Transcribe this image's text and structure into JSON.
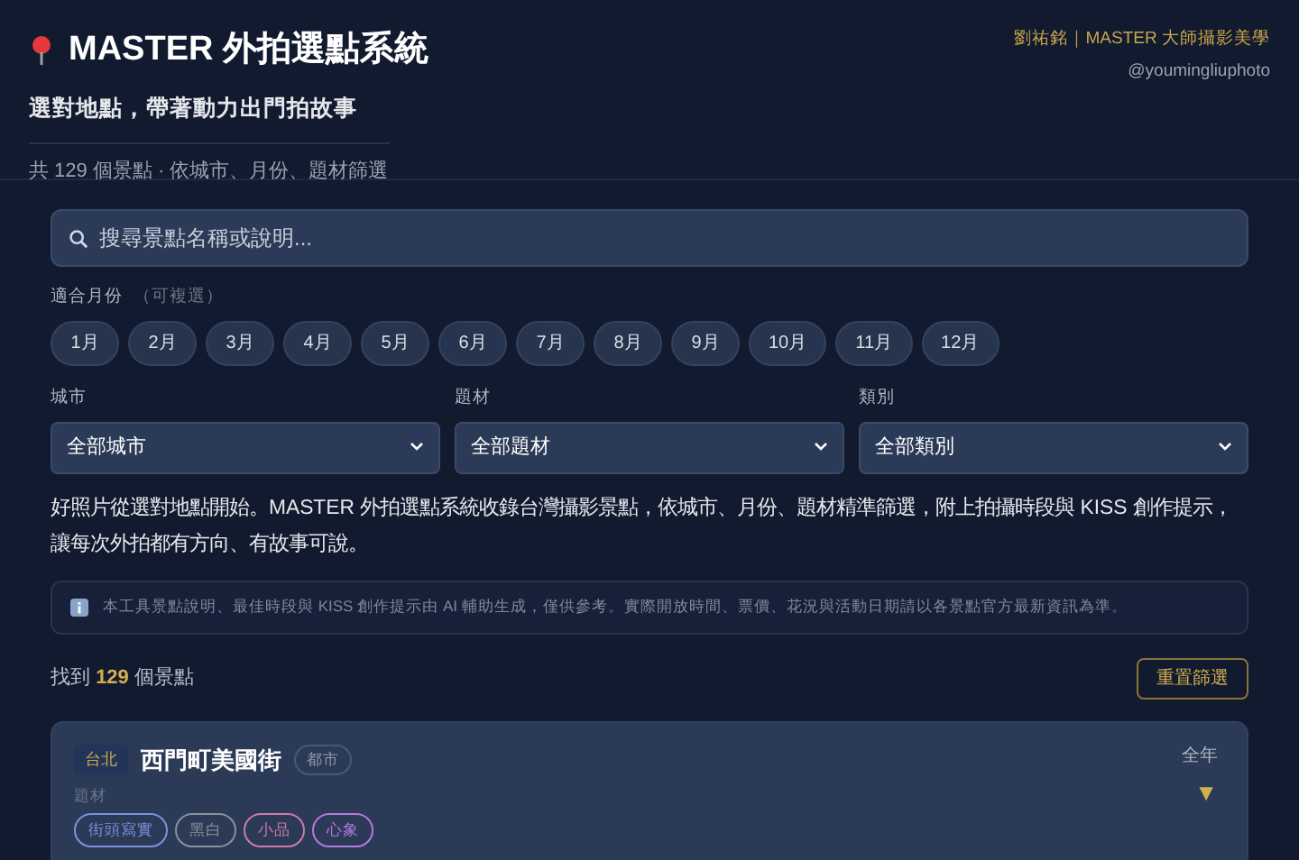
{
  "header": {
    "title": "MASTER 外拍選點系統",
    "subtitle": "選對地點，帶著動力出門拍故事",
    "summary": "共 129 個景點 · 依城市、月份、題材篩選",
    "author": "劉祐銘｜MASTER 大師攝影美學",
    "handle": "@youmingliuphoto"
  },
  "search": {
    "placeholder": "搜尋景點名稱或說明..."
  },
  "months": {
    "label": "適合月份",
    "hint": "（可複選）",
    "items": [
      {
        "label": "1月",
        "selected": false
      },
      {
        "label": "2月",
        "selected": false
      },
      {
        "label": "3月",
        "selected": false
      },
      {
        "label": "4月",
        "selected": false
      },
      {
        "label": "5月",
        "selected": false
      },
      {
        "label": "6月",
        "selected": false
      },
      {
        "label": "7月",
        "selected": false
      },
      {
        "label": "8月",
        "selected": false
      },
      {
        "label": "9月",
        "selected": false
      },
      {
        "label": "10月",
        "selected": false
      },
      {
        "label": "11月",
        "selected": false
      },
      {
        "label": "12月",
        "selected": false
      }
    ]
  },
  "filters": [
    {
      "label": "城市",
      "value": "全部城市"
    },
    {
      "label": "題材",
      "value": "全部題材"
    },
    {
      "label": "類別",
      "value": "全部類別"
    }
  ],
  "intro": "好照片從選對地點開始。MASTER 外拍選點系統收錄台灣攝影景點，依城市、月份、題材精準篩選，附上拍攝時段與 KISS 創作提示，讓每次外拍都有方向、有故事可說。",
  "notice": "本工具景點說明、最佳時段與 KISS 創作提示由 AI 輔助生成，僅供參考。實際開放時間、票價、花況與活動日期請以各景點官方最新資訊為準。",
  "results": {
    "prefix": "找到",
    "count": "129",
    "suffix": "個景點",
    "reset": "重置篩選"
  },
  "spots": [
    {
      "city": "台北",
      "name": "西門町美國街",
      "category": "都市",
      "season": "全年",
      "expand": "▼",
      "tags_label": "題材",
      "tags": [
        {
          "label": "街頭寫實",
          "color": "#7b93e0"
        },
        {
          "label": "黑白",
          "color": "#8a919c"
        },
        {
          "label": "小品",
          "color": "#d07aa8"
        },
        {
          "label": "心象",
          "color": "#b57ae0"
        }
      ]
    }
  ]
}
